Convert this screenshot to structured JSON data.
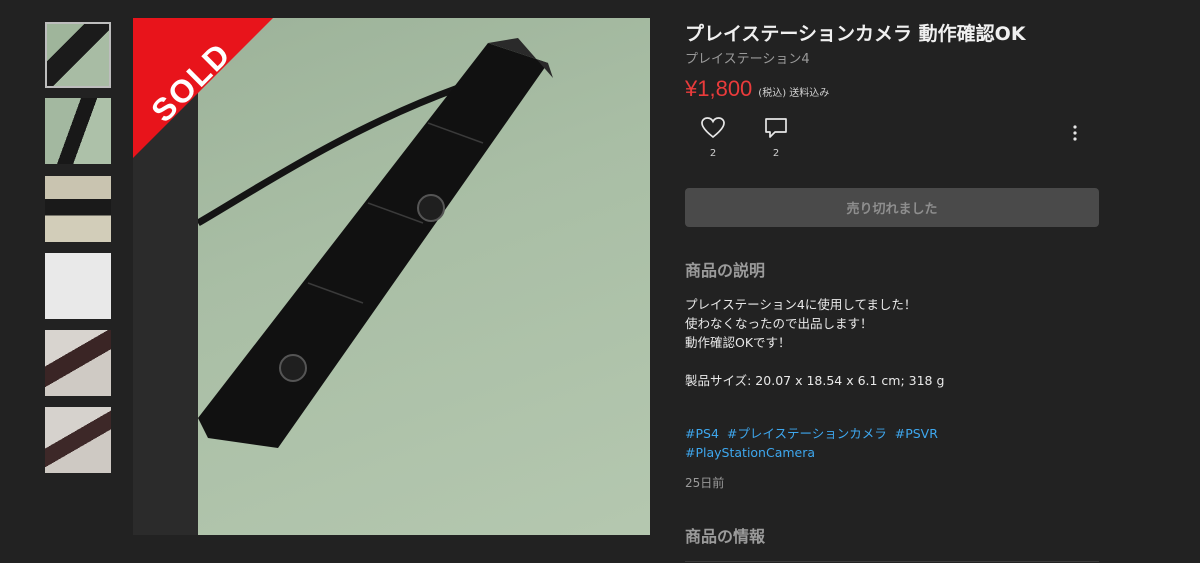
{
  "thumbnails": [
    {
      "label": "thumb-1",
      "active": true
    },
    {
      "label": "thumb-2",
      "active": false
    },
    {
      "label": "thumb-3",
      "active": false
    },
    {
      "label": "thumb-4",
      "active": false
    },
    {
      "label": "thumb-5",
      "active": false
    },
    {
      "label": "thumb-6",
      "active": false
    }
  ],
  "viewer": {
    "sold_label": "SOLD",
    "next_icon": "chevron-right-icon"
  },
  "product": {
    "title": "プレイステーションカメラ 動作確認OK",
    "brand": "プレイステーション4",
    "price": "¥1,800",
    "tax_note": "(税込) 送料込み",
    "like_count": "2",
    "comment_count": "2",
    "sold_out_label": "売り切れました"
  },
  "description": {
    "heading": "商品の説明",
    "body": "プレイステーション4に使用してました！\n使わなくなったので出品します！\n動作確認OKです！\n\n製品サイズ: 20.07 x 18.54 x 6.1 cm; 318 g",
    "tags": [
      "#PS4",
      "#プレイステーションカメラ",
      "#PSVR",
      "#PlayStationCamera"
    ],
    "posted": "25日前"
  },
  "info_section": {
    "heading": "商品の情報"
  },
  "colors": {
    "background": "#222222",
    "price": "#ea3b3b",
    "sold_ribbon": "#e8141b",
    "tag_link": "#3ea7ee"
  }
}
